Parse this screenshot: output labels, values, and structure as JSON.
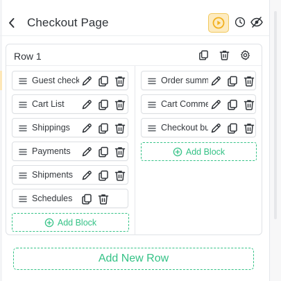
{
  "header": {
    "title": "Checkout Page",
    "icons": [
      "chevron-left-icon",
      "play-circle-icon",
      "clock-icon",
      "eye-icon"
    ]
  },
  "row": {
    "title": "Row 1",
    "actions": [
      "copy-icon",
      "trash-icon",
      "gear-icon"
    ],
    "columns": [
      {
        "blocks": [
          {
            "label": "Guest checkout"
          },
          {
            "label": "Cart List"
          },
          {
            "label": "Shippings"
          },
          {
            "label": "Payments"
          },
          {
            "label": "Shipments"
          },
          {
            "label": "Schedules"
          }
        ],
        "add_block_label": "Add Block"
      },
      {
        "blocks": [
          {
            "label": "Order summary"
          },
          {
            "label": "Cart Comments"
          },
          {
            "label": "Checkout button"
          }
        ],
        "add_block_label": "Add Block"
      }
    ]
  },
  "add_row_label": "Add New Row",
  "colors": {
    "accent_green": "#34c286",
    "preview_bg": "#fdebc0",
    "preview_border": "#f1c85c",
    "preview_icon": "#f2b01e",
    "icon_gray": "#3a3f45",
    "border": "#dfe2e6"
  }
}
